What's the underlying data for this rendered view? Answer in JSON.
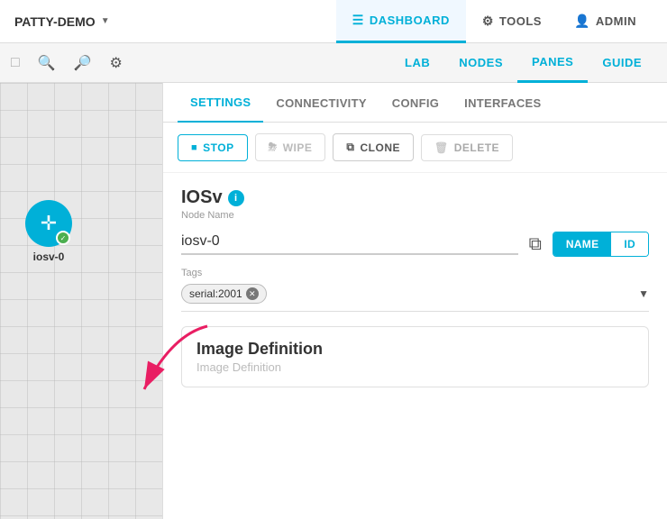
{
  "topNav": {
    "brand": "PATTY-DEMO",
    "items": [
      {
        "label": "DASHBOARD",
        "icon": "≡",
        "active": true
      },
      {
        "label": "TOOLS",
        "icon": "⚙",
        "active": false
      },
      {
        "label": "ADMIN",
        "icon": "👤",
        "active": false
      }
    ]
  },
  "toolbar": {
    "icons": [
      "⊡",
      "🔍-",
      "🔍+",
      "⚙"
    ],
    "subNavItems": [
      {
        "label": "LAB",
        "active": false
      },
      {
        "label": "NODES",
        "active": false
      },
      {
        "label": "PANES",
        "active": true
      },
      {
        "label": "GUIDE",
        "active": false
      }
    ]
  },
  "node": {
    "label": "iosv-0"
  },
  "panel": {
    "tabs": [
      {
        "label": "SETTINGS",
        "active": true
      },
      {
        "label": "CONNECTIVITY",
        "active": false
      },
      {
        "label": "CONFIG",
        "active": false
      },
      {
        "label": "INTERFACES",
        "active": false
      }
    ],
    "actions": [
      {
        "key": "stop",
        "label": "STOP",
        "icon": "■"
      },
      {
        "key": "wipe",
        "label": "WIPE",
        "icon": "🗑"
      },
      {
        "key": "clone",
        "label": "CLONE",
        "icon": "⧉"
      },
      {
        "key": "delete",
        "label": "DELETE",
        "icon": "🗑"
      }
    ],
    "nodeTitle": "IOSv",
    "nodeNameLabel": "Node Name",
    "nodeNameValue": "iosv-0",
    "toggleName": "NAME",
    "toggleId": "ID",
    "tagsLabel": "Tags",
    "tags": [
      {
        "label": "serial:2001"
      }
    ],
    "imageDefTitle": "Image Definition",
    "imageDefSubtitle": "Image Definition"
  }
}
